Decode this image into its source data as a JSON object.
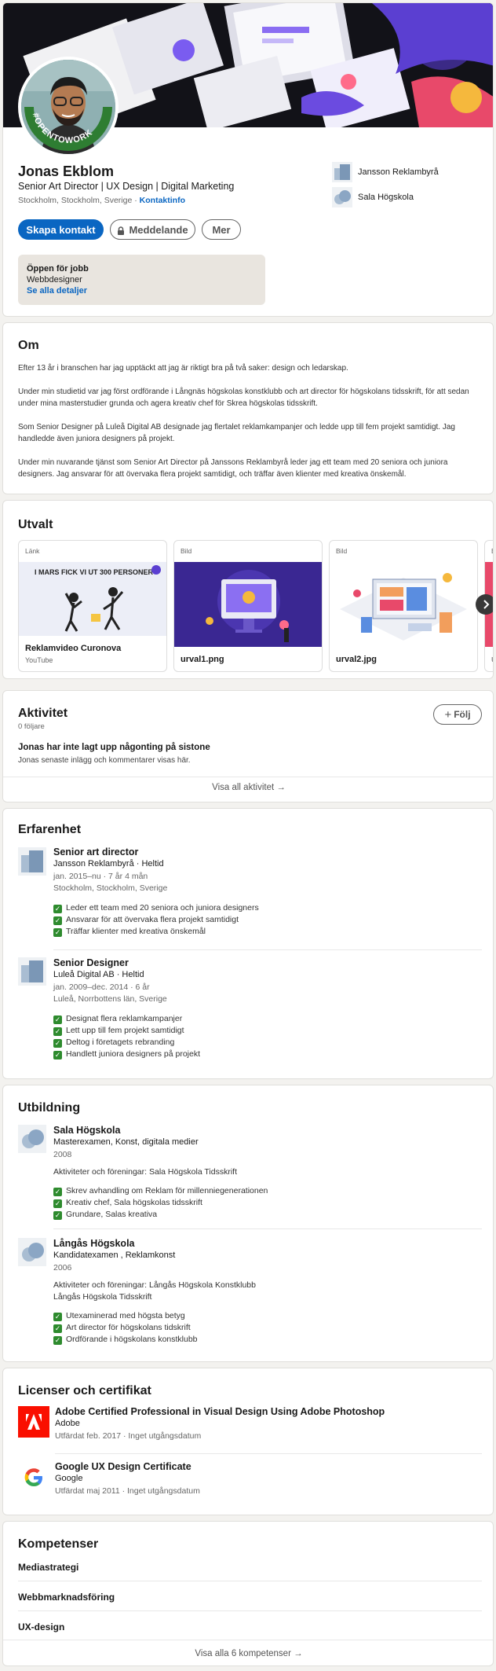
{
  "profile": {
    "name": "Jonas Ekblom",
    "headline": "Senior Art Director | UX Design | Digital Marketing",
    "location": "Stockholm, Stockholm, Sverige ·",
    "contact_link": "Kontaktinfo",
    "badge_text": "#OPENTOWORK",
    "companies": [
      {
        "name": "Jansson Reklambyrå"
      },
      {
        "name": "Sala Högskola"
      }
    ],
    "buttons": {
      "connect": "Skapa kontakt",
      "message": "Meddelande",
      "more": "Mer"
    },
    "open_to_work": {
      "title": "Öppen för jobb",
      "role": "Webbdesigner",
      "link": "Se alla detaljer"
    }
  },
  "about": {
    "title": "Om",
    "paragraphs": [
      "Efter 13 år i branschen har jag upptäckt att jag är riktigt bra på två saker: design och ledarskap.",
      "Under min studietid var jag först ordförande i Långnäs högskolas konstklubb och art director för högskolans tidsskrift, för att sedan under mina masterstudier grunda och agera kreativ chef för Skrea högskolas tidsskrift.",
      "Som Senior Designer på Luleå Digital AB designade jag flertalet reklamkampanjer och ledde upp till fem projekt samtidigt. Jag handledde även juniora designers på projekt.",
      "Under min nuvarande tjänst som Senior Art Director på Janssons Reklambyrå leder jag ett team med 20 seniora och juniora designers. Jag ansvarar för att övervaka flera projekt samtidigt, och träffar även klienter med kreativa önskemål."
    ]
  },
  "featured": {
    "title": "Utvalt",
    "items": [
      {
        "type": "Länk",
        "title": "Reklamvideo Curonova",
        "sub": "YouTube",
        "image_text": "I MARS FICK VI UT 300 PERSONER"
      },
      {
        "type": "Bild",
        "title": "urval1.png",
        "sub": ""
      },
      {
        "type": "Bild",
        "title": "urval2.jpg",
        "sub": ""
      }
    ],
    "peek_type": "B",
    "peek_title": "u"
  },
  "activity": {
    "title": "Aktivitet",
    "followers": "0 följare",
    "follow_button": "Följ",
    "empty_title": "Jonas har inte lagt upp någonting på sistone",
    "empty_sub": "Jonas senaste inlägg och kommentarer visas här.",
    "show_all": "Visa all aktivitet"
  },
  "experience": {
    "title": "Erfarenhet",
    "items": [
      {
        "role": "Senior art director",
        "company": "Jansson Reklambyrå · Heltid",
        "dates": "jan. 2015–nu · 7 år 4 mån",
        "location": "Stockholm, Stockholm, Sverige",
        "bullets": [
          "Leder ett team med 20 seniora och juniora designers",
          "Ansvarar för att övervaka flera projekt samtidigt",
          "Träffar klienter med kreativa önskemål"
        ]
      },
      {
        "role": "Senior Designer",
        "company": "Luleå Digital AB · Heltid",
        "dates": "jan. 2009–dec. 2014 · 6 år",
        "location": "Luleå, Norrbottens län, Sverige",
        "bullets": [
          "Designat flera reklamkampanjer",
          "Lett upp till fem projekt samtidigt",
          "Deltog i företagets rebranding",
          "Handlett juniora designers på projekt"
        ]
      }
    ]
  },
  "education": {
    "title": "Utbildning",
    "items": [
      {
        "school": "Sala Högskola",
        "degree": "Masterexamen, Konst, digitala medier",
        "year": "2008",
        "activities": "Aktiviteter och föreningar: Sala Högskola Tidsskrift",
        "activities2": "",
        "bullets": [
          "Skrev avhandling om Reklam för millenniegenerationen",
          "Kreativ chef, Sala högskolas tidsskrift",
          "Grundare, Salas kreativa"
        ]
      },
      {
        "school": "Långås Högskola",
        "degree": "Kandidatexamen , Reklamkonst",
        "year": "2006",
        "activities": "Aktiviteter och föreningar: Långås Högskola Konstklubb",
        "activities2": "Långås Högskola Tidsskrift",
        "bullets": [
          "Utexaminerad med högsta betyg",
          "Art director för högskolans tidskrift",
          "Ordförande i högskolans konstklubb"
        ]
      }
    ]
  },
  "certs": {
    "title": "Licenser och certifikat",
    "items": [
      {
        "name": "Adobe Certified Professional in Visual Design Using Adobe Photoshop",
        "issuer": "Adobe",
        "date": "Utfärdat feb. 2017 · Inget utgångsdatum"
      },
      {
        "name": "Google UX Design Certificate",
        "issuer": "Google",
        "date": "Utfärdat maj 2011 · Inget utgångsdatum"
      }
    ]
  },
  "skills": {
    "title": "Kompetenser",
    "items": [
      "Mediastrategi",
      "Webbmarknadsföring",
      "UX-design"
    ],
    "show_all": "Visa alla 6 kompetenser"
  },
  "colors": {
    "accent": "#0a66c2",
    "open_to_work_green": "#2e7d32",
    "check_green": "#2e8b2e",
    "adobe_red": "#fa0f00"
  }
}
